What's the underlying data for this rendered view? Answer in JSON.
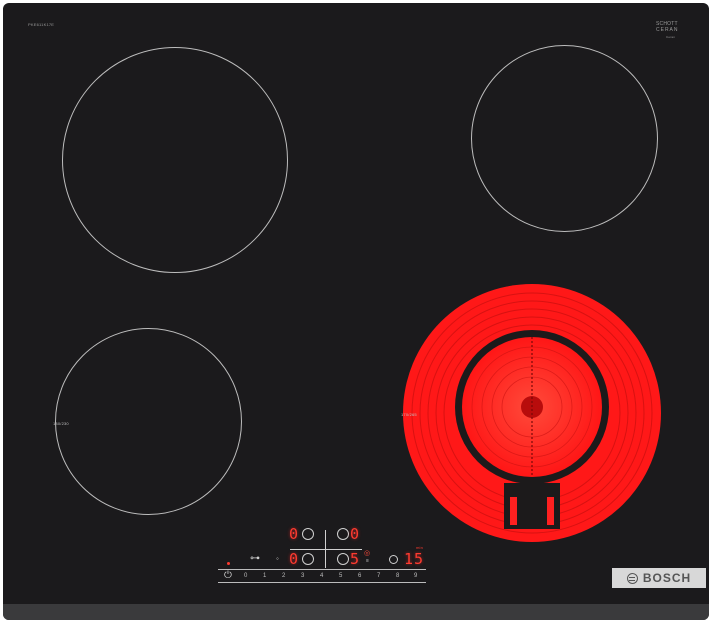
{
  "hob": {
    "model_text": "PKE611K17E",
    "logo_top": "SCHOTT",
    "logo_middle": "CERAN",
    "logo_bottom": "Ceran"
  },
  "zones": {
    "rear_left_label": "",
    "front_left_label": "180/230",
    "front_right_label": "170/265"
  },
  "controls": {
    "rear_left_display": "0",
    "rear_right_display": "0",
    "front_left_display": "0",
    "front_right_display": "5",
    "timer_display": "15",
    "timer_unit": "min",
    "lock_symbol": "⊶",
    "power_symbol": "⏻",
    "slider_ticks": [
      "0",
      "1",
      "2",
      "3",
      "4",
      "5",
      "6",
      "7",
      "8",
      "9"
    ]
  },
  "brand": {
    "label": "BOSCH"
  },
  "colors": {
    "glass": "#1b1a1c",
    "heating": "#ff1f1f",
    "display": "#ff3b30"
  }
}
